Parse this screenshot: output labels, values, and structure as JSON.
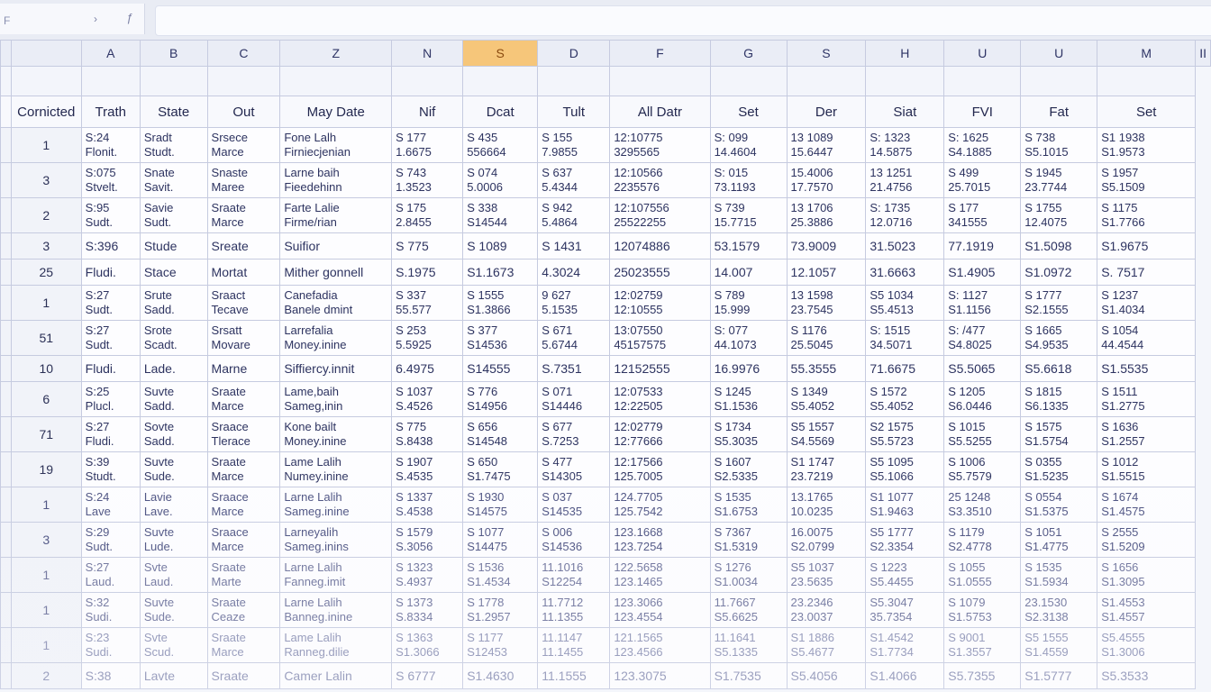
{
  "namebox": {
    "text": "F",
    "chevron": "›",
    "fx": "ƒ"
  },
  "columns": [
    "A",
    "B",
    "C",
    "Z",
    "N",
    "S",
    "D",
    "F",
    "G",
    "S",
    "H",
    "U",
    "U",
    "M",
    "II"
  ],
  "active_column_index": 5,
  "fields": [
    "Cornicted",
    "Trath",
    "State",
    "Out",
    "May Date",
    "Nif",
    "Dcat",
    "Tult",
    "All Datr",
    "Set",
    "Der",
    "Siat",
    "FVI",
    "Fat",
    "Set"
  ],
  "rows": [
    {
      "num": "1",
      "cells": [
        [
          "S:24",
          "Flonit."
        ],
        [
          "Sradt",
          "Studt."
        ],
        [
          "Srsece",
          "Marce"
        ],
        [
          "Fone Lalh",
          "Firniecjenian"
        ],
        [
          "S 177",
          "1.6675"
        ],
        [
          "S 435",
          "556664"
        ],
        [
          "S 155",
          "7.9855"
        ],
        [
          "12:10775",
          "3295565"
        ],
        [
          "S: 099",
          "14.4604"
        ],
        [
          "13 1089",
          "15.6447"
        ],
        [
          "S: 1323",
          "14.5875"
        ],
        [
          "S: 1625",
          "S4.1885"
        ],
        [
          "S 738",
          "S5.1015"
        ],
        [
          "S1 1938",
          "S1.9573"
        ]
      ]
    },
    {
      "num": "3",
      "cells": [
        [
          "S:075",
          "Stvelt."
        ],
        [
          "Snate",
          "Savit."
        ],
        [
          "Snaste",
          "Maree"
        ],
        [
          "Larne baih",
          "Fieedehinn"
        ],
        [
          "S 743",
          "1.3523"
        ],
        [
          "S 074",
          "5.0006"
        ],
        [
          "S 637",
          "5.4344"
        ],
        [
          "12:10566",
          "2235576"
        ],
        [
          "S: 015",
          "73.1193"
        ],
        [
          "15.4006",
          "17.7570"
        ],
        [
          "13 1251",
          "21.4756"
        ],
        [
          "S 499",
          "25.7015"
        ],
        [
          "S 1945",
          "23.7744"
        ],
        [
          "S 1957",
          "S5.1509"
        ]
      ]
    },
    {
      "num": "2",
      "cells": [
        [
          "S:95",
          "Sudt."
        ],
        [
          "Savie",
          "Sudt."
        ],
        [
          "Sraate",
          "Marce"
        ],
        [
          "Farte Lalie",
          "Firme/rian"
        ],
        [
          "S 175",
          "2.8455"
        ],
        [
          "S 338",
          "S14544"
        ],
        [
          "S 942",
          "5.4864"
        ],
        [
          "12:107556",
          "25522255"
        ],
        [
          "S 739",
          "15.7715"
        ],
        [
          "13 1706",
          "25.3886"
        ],
        [
          "S: 1735",
          "12.0716"
        ],
        [
          "S 177",
          "341555"
        ],
        [
          "S 1755",
          "12.4075"
        ],
        [
          "S 1175",
          "S1.7766"
        ]
      ]
    },
    {
      "num": "3",
      "single": true,
      "cells": [
        [
          "S:396"
        ],
        [
          "Stude"
        ],
        [
          "Sreate"
        ],
        [
          "Suifior"
        ],
        [
          "S 775"
        ],
        [
          "S 1089"
        ],
        [
          "S 1431"
        ],
        [
          "12074886"
        ],
        [
          "53.1579"
        ],
        [
          "73.9009"
        ],
        [
          "31.5023"
        ],
        [
          "77.1919"
        ],
        [
          "S1.5098"
        ],
        [
          "S1.9675"
        ]
      ]
    },
    {
      "num": "25",
      "single": true,
      "cells": [
        [
          "Fludi."
        ],
        [
          "Stace"
        ],
        [
          "Mortat"
        ],
        [
          "Mither gonnell"
        ],
        [
          "S.1975"
        ],
        [
          "S1.1673"
        ],
        [
          "4.3024"
        ],
        [
          "25023555"
        ],
        [
          "14.007"
        ],
        [
          "12.1057"
        ],
        [
          "31.6663"
        ],
        [
          "S1.4905"
        ],
        [
          "S1.0972"
        ],
        [
          "S. 7517"
        ]
      ]
    },
    {
      "num": "1",
      "cells": [
        [
          "S:27",
          "Sudt."
        ],
        [
          "Srute",
          "Sadd."
        ],
        [
          "Sraact",
          "Tecave"
        ],
        [
          "Canefadia",
          "Banele dmint"
        ],
        [
          "S 337",
          "55.577"
        ],
        [
          "S 1555",
          "S1.3866"
        ],
        [
          "9 627",
          "5.1535"
        ],
        [
          "12:02759",
          "12:10555"
        ],
        [
          "S 789",
          "15.999"
        ],
        [
          "13 1598",
          "23.7545"
        ],
        [
          "S5 1034",
          "S5.4513"
        ],
        [
          "S: 1127",
          "S1.1156"
        ],
        [
          "S 1777",
          "S2.1555"
        ],
        [
          "S 1237",
          "S1.4034"
        ]
      ]
    },
    {
      "num": "51",
      "cells": [
        [
          "S:27",
          "Sudt."
        ],
        [
          "Srote",
          "Scadt."
        ],
        [
          "Srsatt",
          "Movare"
        ],
        [
          "Larrefalia",
          "Money.inine"
        ],
        [
          "S 253",
          "5.5925"
        ],
        [
          "S 377",
          "S14536"
        ],
        [
          "S 671",
          "5.6744"
        ],
        [
          "13:07550",
          "45157575"
        ],
        [
          "S: 077",
          "44.1073"
        ],
        [
          "S 1176",
          "25.5045"
        ],
        [
          "S: 1515",
          "34.5071"
        ],
        [
          "S: /477",
          "S4.8025"
        ],
        [
          "S 1665",
          "S4.9535"
        ],
        [
          "S 1054",
          "44.4544"
        ]
      ]
    },
    {
      "num": "10",
      "single": true,
      "cells": [
        [
          "Fludi."
        ],
        [
          "Lade."
        ],
        [
          "Marne"
        ],
        [
          "Siffiercy.innit"
        ],
        [
          "6.4975"
        ],
        [
          "S14555"
        ],
        [
          "S.7351"
        ],
        [
          "12152555"
        ],
        [
          "16.9976"
        ],
        [
          "55.3555"
        ],
        [
          "71.6675"
        ],
        [
          "S5.5065"
        ],
        [
          "S5.6618"
        ],
        [
          "S1.5535"
        ]
      ]
    },
    {
      "num": "6",
      "cells": [
        [
          "S:25",
          "Plucl."
        ],
        [
          "Suvte",
          "Sadd."
        ],
        [
          "Sraate",
          "Marce"
        ],
        [
          "Lame,baih",
          "Sameg,inin"
        ],
        [
          "S 1037",
          "S.4526"
        ],
        [
          "S 776",
          "S14956"
        ],
        [
          "S 071",
          "S14446"
        ],
        [
          "12:07533",
          "12:22505"
        ],
        [
          "S 1245",
          "S1.1536"
        ],
        [
          "S 1349",
          "S5.4052"
        ],
        [
          "S 1572",
          "S5.4052"
        ],
        [
          "S 1205",
          "S6.0446"
        ],
        [
          "S 1815",
          "S6.1335"
        ],
        [
          "S 1511",
          "S1.2775"
        ]
      ]
    },
    {
      "num": "71",
      "cells": [
        [
          "S:27",
          "Fludi."
        ],
        [
          "Sovte",
          "Sadd."
        ],
        [
          "Sraace",
          "Tlerace"
        ],
        [
          "Kone bailt",
          "Money.inine"
        ],
        [
          "S 775",
          "S.8438"
        ],
        [
          "S 656",
          "S14548"
        ],
        [
          "S 677",
          "S.7253"
        ],
        [
          "12:02779",
          "12:77666"
        ],
        [
          "S 1734",
          "S5.3035"
        ],
        [
          "S5 1557",
          "S4.5569"
        ],
        [
          "S2 1575",
          "S5.5723"
        ],
        [
          "S 1015",
          "S5.5255"
        ],
        [
          "S 1575",
          "S1.5754"
        ],
        [
          "S 1636",
          "S1.2557"
        ]
      ]
    },
    {
      "num": "19",
      "cells": [
        [
          "S:39",
          "Studt."
        ],
        [
          "Suvte",
          "Sude."
        ],
        [
          "Sraate",
          "Marce"
        ],
        [
          "Lame Lalih",
          "Numey.inine"
        ],
        [
          "S 1907",
          "S.4535"
        ],
        [
          "S 650",
          "S1.7475"
        ],
        [
          "S 477",
          "S14305"
        ],
        [
          "12:17566",
          "125.7005"
        ],
        [
          "S 1607",
          "S2.5335"
        ],
        [
          "S1 1747",
          "23.7219"
        ],
        [
          "S5 1095",
          "S5.1066"
        ],
        [
          "S 1006",
          "S5.7579"
        ],
        [
          "S 0355",
          "S1.5235"
        ],
        [
          "S 1012",
          "S1.5515"
        ]
      ]
    },
    {
      "num": "1",
      "fade": 1,
      "cells": [
        [
          "S:24",
          "Lave"
        ],
        [
          "Lavie",
          "Lave."
        ],
        [
          "Sraace",
          "Marce"
        ],
        [
          "Larne Lalih",
          "Sameg.inine"
        ],
        [
          "S 1337",
          "S.4538"
        ],
        [
          "S 1930",
          "S14575"
        ],
        [
          "S 037",
          "S14535"
        ],
        [
          "124.7705",
          "125.7542"
        ],
        [
          "S 1535",
          "S1.6753"
        ],
        [
          "13.1765",
          "10.0235"
        ],
        [
          "S1 1077",
          "S1.9463"
        ],
        [
          "25 1248",
          "S3.3510"
        ],
        [
          "S 0554",
          "S1.5375"
        ],
        [
          "S 1674",
          "S1.4575"
        ]
      ]
    },
    {
      "num": "3",
      "fade": 1,
      "cells": [
        [
          "S:29",
          "Sudt."
        ],
        [
          "Suvte",
          "Lude."
        ],
        [
          "Sraace",
          "Marce"
        ],
        [
          "Larneyalih",
          "Sameg.inins"
        ],
        [
          "S 1579",
          "S.3056"
        ],
        [
          "S 1077",
          "S14475"
        ],
        [
          "S 006",
          "S14536"
        ],
        [
          "123.1668",
          "123.7254"
        ],
        [
          "S 7367",
          "S1.5319"
        ],
        [
          "16.0075",
          "S2.0799"
        ],
        [
          "S5 1777",
          "S2.3354"
        ],
        [
          "S 1179",
          "S2.4778"
        ],
        [
          "S 1051",
          "S1.4775"
        ],
        [
          "S 2555",
          "S1.5209"
        ]
      ]
    },
    {
      "num": "1",
      "fade": 2,
      "cells": [
        [
          "S:27",
          "Laud."
        ],
        [
          "Svte",
          "Laud."
        ],
        [
          "Sraate",
          "Marte"
        ],
        [
          "Larne Lalih",
          "Fanneg.imit"
        ],
        [
          "S 1323",
          "S.4937"
        ],
        [
          "S 1536",
          "S1.4534"
        ],
        [
          "11.1016",
          "S12254"
        ],
        [
          "122.5658",
          "123.1465"
        ],
        [
          "S 1276",
          "S1.0034"
        ],
        [
          "S5 1037",
          "23.5635"
        ],
        [
          "S 1223",
          "S5.4455"
        ],
        [
          "S 1055",
          "S1.0555"
        ],
        [
          "S 1535",
          "S1.5934"
        ],
        [
          "S 1656",
          "S1.3095"
        ]
      ]
    },
    {
      "num": "1",
      "fade": 2,
      "cells": [
        [
          "S:32",
          "Sudi."
        ],
        [
          "Suvte",
          "Sude."
        ],
        [
          "Sraate",
          "Ceaze"
        ],
        [
          "Larne Lalih",
          "Banneg.inine"
        ],
        [
          "S 1373",
          "S.8334"
        ],
        [
          "S 1778",
          "S1.2957"
        ],
        [
          "11.7712",
          "11.1355"
        ],
        [
          "123.3066",
          "123.4554"
        ],
        [
          "11.7667",
          "S5.6625"
        ],
        [
          "23.2346",
          "23.0037"
        ],
        [
          "S5.3047",
          "35.7354"
        ],
        [
          "S 1079",
          "S1.5753"
        ],
        [
          "23.1530",
          "S2.3138"
        ],
        [
          "S1.4553",
          "S1.4557"
        ]
      ]
    },
    {
      "num": "1",
      "fade": 3,
      "cells": [
        [
          "S:23",
          "Sudi."
        ],
        [
          "Svte",
          "Scud."
        ],
        [
          "Sraate",
          "Marce"
        ],
        [
          "Lame Lalih",
          "Ranneg.dilie"
        ],
        [
          "S 1363",
          "S1.3066"
        ],
        [
          "S 1177",
          "S12453"
        ],
        [
          "11.1147",
          "11.1455"
        ],
        [
          "121.1565",
          "123.4566"
        ],
        [
          "11.1641",
          "S5.1335"
        ],
        [
          "S1 1886",
          "S5.4677"
        ],
        [
          "S1.4542",
          "S1.7734"
        ],
        [
          "S 9001",
          "S1.3557"
        ],
        [
          "S5 1555",
          "S1.4559"
        ],
        [
          "S5.4555",
          "S1.3006"
        ]
      ]
    },
    {
      "num": "2",
      "single": true,
      "fade": 3,
      "cells": [
        [
          "S:38"
        ],
        [
          "Lavte"
        ],
        [
          "Sraate"
        ],
        [
          "Camer Lalin"
        ],
        [
          "S 6777"
        ],
        [
          "S1.4630"
        ],
        [
          "11.1555"
        ],
        [
          "123.3075"
        ],
        [
          "S1.7535"
        ],
        [
          "S5.4056"
        ],
        [
          "S1.4066"
        ],
        [
          "S5.7355"
        ],
        [
          "S1.5777"
        ],
        [
          "S5.3533"
        ]
      ]
    }
  ]
}
